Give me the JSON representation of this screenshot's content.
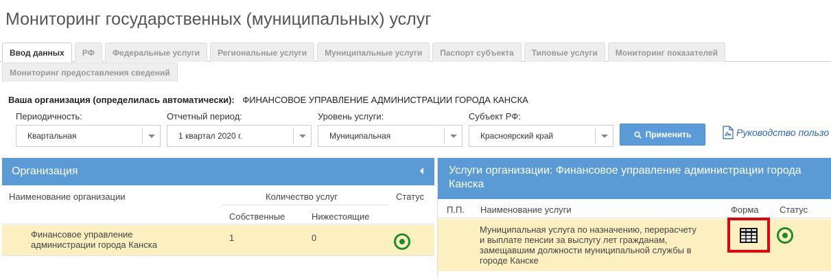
{
  "page": {
    "title": "Мониторинг государственных (муниципальных) услуг"
  },
  "tabs_row1": [
    {
      "label": "Ввод данных",
      "active": true
    },
    {
      "label": "РФ",
      "active": false
    },
    {
      "label": "Федеральные услуги",
      "active": false
    },
    {
      "label": "Региональные услуги",
      "active": false
    },
    {
      "label": "Муниципальные услуги",
      "active": false
    },
    {
      "label": "Паспорт субъекта",
      "active": false
    },
    {
      "label": "Типовые услуги",
      "active": false
    },
    {
      "label": "Мониторинг показателей",
      "active": false
    }
  ],
  "tabs_row2": [
    {
      "label": "Мониторинг предоставления сведений",
      "active": false
    }
  ],
  "org": {
    "label": "Ваша организация (определилась автоматически):",
    "value": "ФИНАНСОВОЕ УПРАВЛЕНИЕ АДМИНИСТРАЦИИ ГОРОДА КАНСКА"
  },
  "filters": {
    "periodicity": {
      "label": "Периодичность:",
      "value": "Квартальная"
    },
    "period": {
      "label": "Отчетный период:",
      "value": "1 квартал 2020 г."
    },
    "level": {
      "label": "Уровень услуги:",
      "value": "Муниципальная"
    },
    "subject": {
      "label": "Субъект РФ:",
      "value": "Красноярский край"
    }
  },
  "apply_button": {
    "label": "Применить",
    "icon": "search-icon"
  },
  "manual_link": {
    "label": "Руководство пользо",
    "icon": "pdf-icon"
  },
  "left_panel": {
    "title": "Организация",
    "headers": {
      "name": "Наименование организации",
      "count": "Количество услуг",
      "status": "Статус",
      "own": "Собственные",
      "sub": "Нижестоящие"
    },
    "rows": [
      {
        "name_line1": "Финансовое управление",
        "name_line2": "администрации города Канска",
        "own": "1",
        "sub": "0",
        "status": "active"
      }
    ]
  },
  "right_panel": {
    "title_line1": "Услуги организации: Финансовое управление администрации города",
    "title_line2": "Канска",
    "headers": {
      "pp": "П.П.",
      "name": "Наименование услуги",
      "form": "Форма",
      "status": "Статус"
    },
    "rows": [
      {
        "line1": "Муниципальная услуга по назначению, перерасчету",
        "line2": "и выплате пенсии за выслугу лет гражданам,",
        "line3": "замещавшим должности муниципальной службы в",
        "line4": "городе Канске",
        "form_icon": "table-icon",
        "status": "active"
      }
    ]
  },
  "colors": {
    "header_blue": "#5a9bd5",
    "button_blue": "#5b9bd8",
    "row_highlight": "#fcefc0",
    "status_green": "#1f8a2a",
    "highlight_red": "#e3000f",
    "link_blue": "#2a64c5"
  }
}
